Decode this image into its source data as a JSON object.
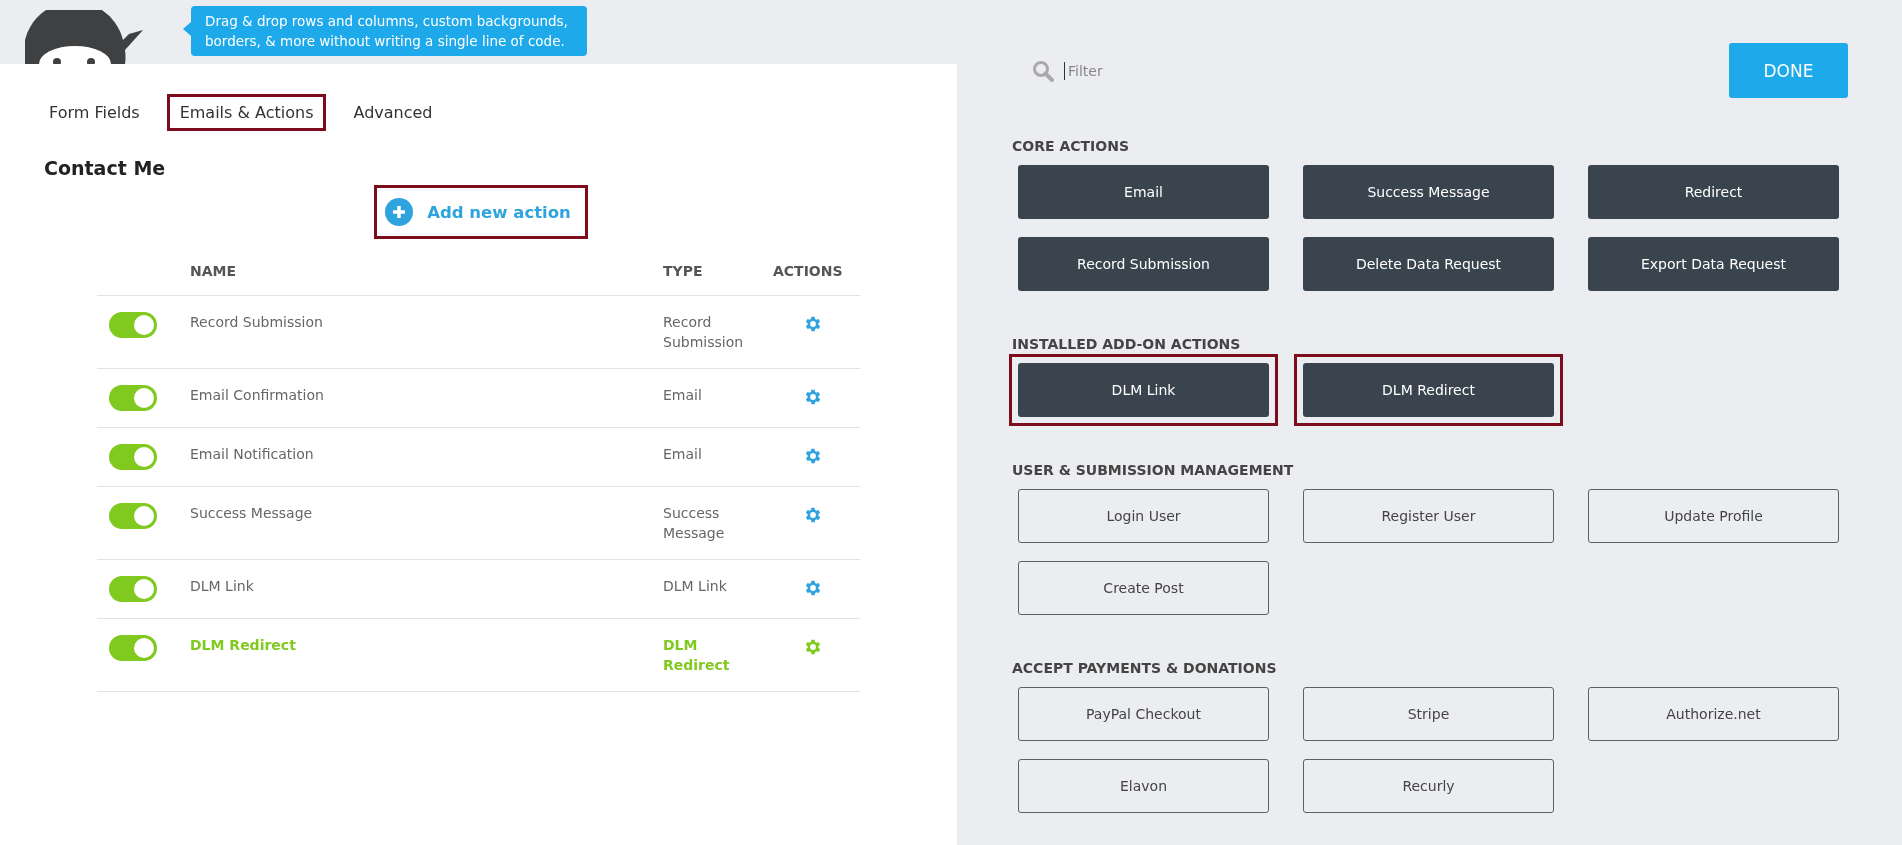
{
  "header": {
    "tooltip": "Drag & drop rows and columns, custom backgrounds, borders, & more without writing a single line of code."
  },
  "tabs": [
    {
      "label": "Form Fields",
      "selected": false
    },
    {
      "label": "Emails & Actions",
      "selected": true
    },
    {
      "label": "Advanced",
      "selected": false
    }
  ],
  "form_title": "Contact Me",
  "add_action": {
    "label": "Add new action",
    "highlighted": true
  },
  "table": {
    "columns": [
      "NAME",
      "TYPE",
      "ACTIONS"
    ],
    "rows": [
      {
        "name": "Record Submission",
        "type": "Record Submission",
        "on": true,
        "selected": false
      },
      {
        "name": "Email Confirmation",
        "type": "Email",
        "on": true,
        "selected": false
      },
      {
        "name": "Email Notification",
        "type": "Email",
        "on": true,
        "selected": false
      },
      {
        "name": "Success Message",
        "type": "Success Message",
        "on": true,
        "selected": false
      },
      {
        "name": "DLM Link",
        "type": "DLM Link",
        "on": true,
        "selected": false
      },
      {
        "name": "DLM Redirect",
        "type": "DLM Redirect",
        "on": true,
        "selected": true
      }
    ]
  },
  "filter": {
    "placeholder": "Filter"
  },
  "done_button": "DONE",
  "sections": [
    {
      "title": "CORE ACTIONS",
      "kind": "filled",
      "actions": [
        {
          "label": "Email",
          "highlighted": false
        },
        {
          "label": "Success Message",
          "highlighted": false
        },
        {
          "label": "Redirect",
          "highlighted": false
        },
        {
          "label": "Record Submission",
          "highlighted": false
        },
        {
          "label": "Delete Data Request",
          "highlighted": false
        },
        {
          "label": "Export Data Request",
          "highlighted": false
        }
      ]
    },
    {
      "title": "INSTALLED ADD-ON ACTIONS",
      "kind": "filled",
      "actions": [
        {
          "label": "DLM Link",
          "highlighted": true
        },
        {
          "label": "DLM Redirect",
          "highlighted": true
        }
      ]
    },
    {
      "title": "USER & SUBMISSION MANAGEMENT",
      "kind": "outline",
      "actions": [
        {
          "label": "Login User",
          "highlighted": false
        },
        {
          "label": "Register User",
          "highlighted": false
        },
        {
          "label": "Update Profile",
          "highlighted": false
        },
        {
          "label": "Create Post",
          "highlighted": false
        }
      ]
    },
    {
      "title": "ACCEPT PAYMENTS & DONATIONS",
      "kind": "outline",
      "actions": [
        {
          "label": "PayPal Checkout",
          "highlighted": false
        },
        {
          "label": "Stripe",
          "highlighted": false
        },
        {
          "label": "Authorize.net",
          "highlighted": false
        },
        {
          "label": "Elavon",
          "highlighted": false
        },
        {
          "label": "Recurly",
          "highlighted": false
        }
      ]
    }
  ]
}
